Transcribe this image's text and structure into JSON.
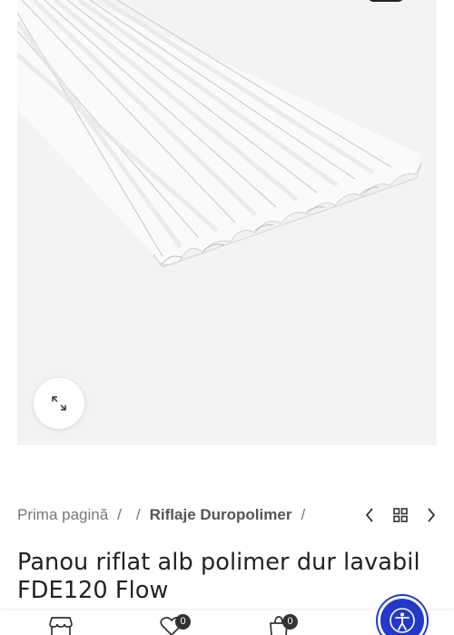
{
  "product_image": {
    "alt_icon": "fluted-panel-product-image"
  },
  "zoom": {
    "icon": "expand-icon"
  },
  "breadcrumb": {
    "home": "Prima pagină",
    "separator": "/",
    "category": "Riflaje Duropolimer"
  },
  "product_nav": {
    "prev_icon": "chevron-left-icon",
    "grid_icon": "grid-icon",
    "next_icon": "chevron-right-icon"
  },
  "product": {
    "title": "Panou riflat alb polimer dur lavabil FDE120 Flow"
  },
  "bottom_bar": {
    "shop_icon": "store-icon",
    "wishlist_count": "0",
    "cart_count": "0"
  },
  "accessibility": {
    "icon": "accessibility-icon",
    "color": "#2239c9"
  }
}
